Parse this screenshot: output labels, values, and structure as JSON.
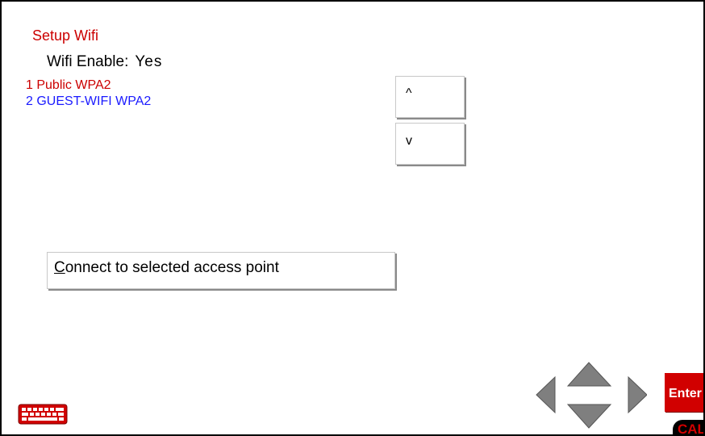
{
  "header": {
    "title": "Setup Wifi"
  },
  "wifi_enable": {
    "label": "Wifi Enable:",
    "value": "Yes"
  },
  "access_points": [
    {
      "label": "1 Public WPA2",
      "color": "#cc0000"
    },
    {
      "label": "2 GUEST-WIFI WPA2",
      "color": "#1a1aff"
    }
  ],
  "scroll": {
    "up_label": "^",
    "down_label": "v"
  },
  "connect_button": {
    "first_letter": "C",
    "rest": "onnect to selected access point"
  },
  "footer": {
    "enter_label": "Enter",
    "cal_label": "CAL",
    "keyboard_icon": "keyboard-icon",
    "nav_icons": [
      "arrow-left-icon",
      "arrow-up-icon",
      "arrow-down-icon",
      "arrow-right-icon"
    ]
  },
  "colors": {
    "title": "#cc0000",
    "enter": "#d10000",
    "nav": "#7f7f7f"
  }
}
